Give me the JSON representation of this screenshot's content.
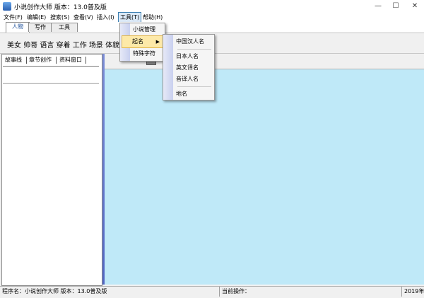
{
  "window": {
    "title": "小说创作大师 版本：13.0普及版",
    "controls": {
      "minimize": "—",
      "maximize": "☐",
      "close": "✕"
    }
  },
  "menubar": {
    "items": [
      {
        "label": "文件(F)"
      },
      {
        "label": "编辑(E)"
      },
      {
        "label": "搜索(S)"
      },
      {
        "label": "查看(V)"
      },
      {
        "label": "插入(I)"
      },
      {
        "label": "工具(T)"
      },
      {
        "label": "帮助(H)"
      }
    ],
    "active": "工具(T)"
  },
  "tabs": [
    "人物",
    "写作",
    "工具"
  ],
  "toolbar": {
    "words": "美女 帅哥 语言 穿着 工作 场景 体貌"
  },
  "left_panel": {
    "tabs": [
      "故事线",
      "章节创作",
      "资料窗口"
    ]
  },
  "tools_menu": {
    "items": [
      "小说管理",
      "起名",
      "特殊字符"
    ],
    "highlighted": "起名"
  },
  "naming_submenu": {
    "items": [
      "中国汉人名",
      "日本人名",
      "英文译名",
      "音译人名",
      "地名"
    ]
  },
  "statusbar": {
    "program": "程序名：小说创作大师 版本：13.0普及版",
    "operation": "当前操作：",
    "year": "2019年"
  },
  "colors": {
    "canvas": "#bfe9f8",
    "splitter": "#5266c4",
    "highlight": "#fde9a8"
  }
}
